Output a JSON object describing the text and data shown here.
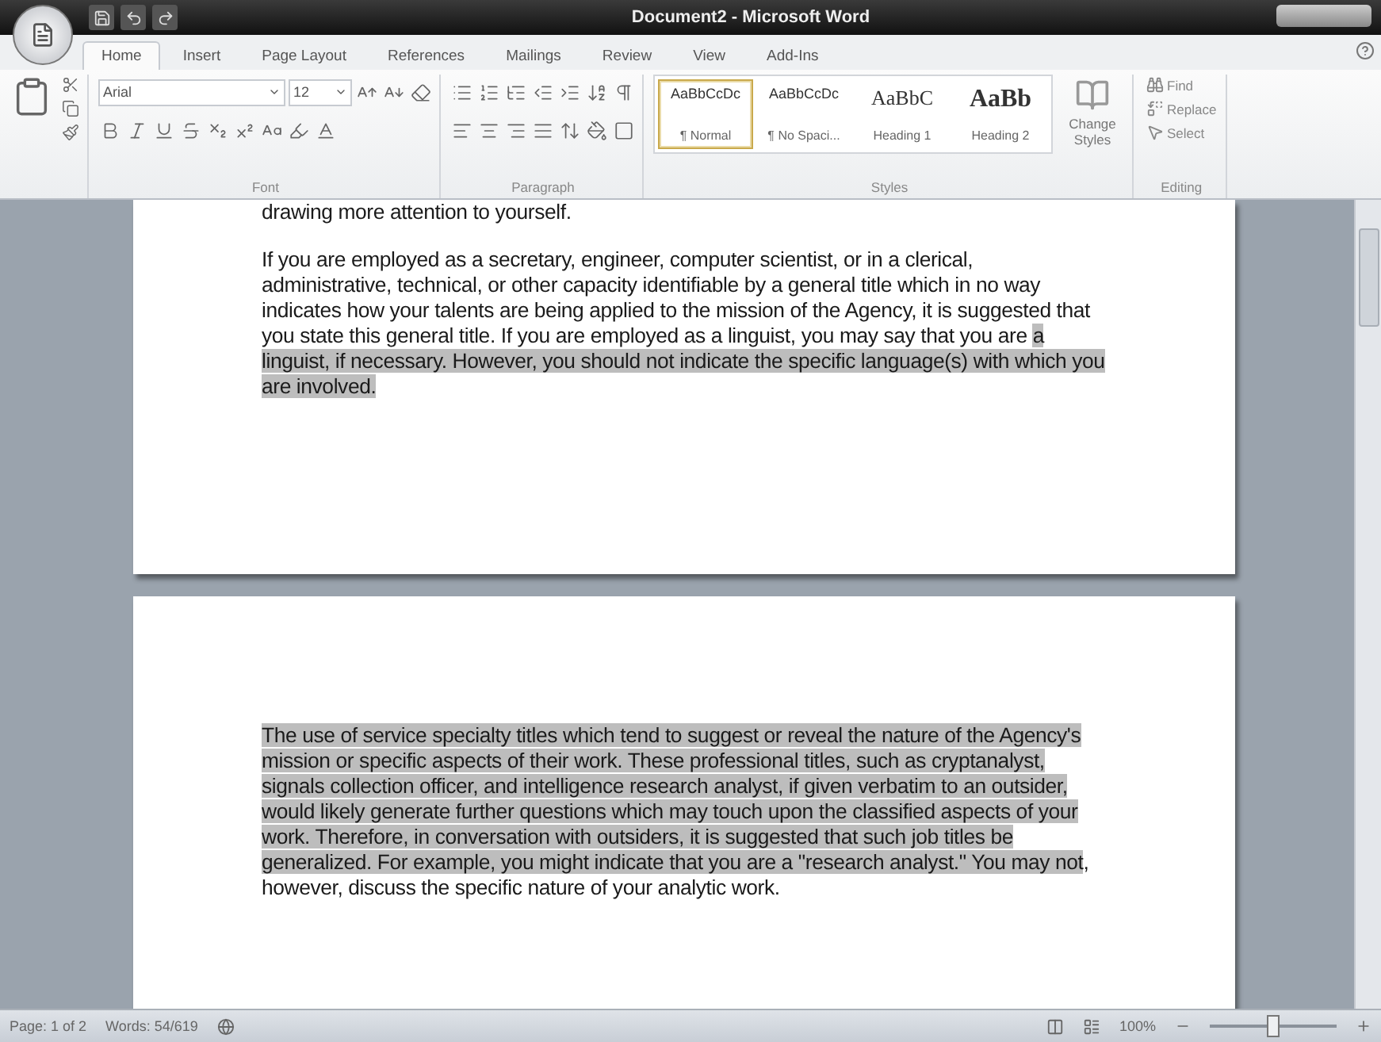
{
  "window": {
    "title": "Document2 - Microsoft Word"
  },
  "ribbon": {
    "tabs": [
      {
        "label": "Home",
        "selected": true
      },
      {
        "label": "Insert",
        "selected": false
      },
      {
        "label": "Page Layout",
        "selected": false
      },
      {
        "label": "References",
        "selected": false
      },
      {
        "label": "Mailings",
        "selected": false
      },
      {
        "label": "Review",
        "selected": false
      },
      {
        "label": "View",
        "selected": false
      },
      {
        "label": "Add-Ins",
        "selected": false
      }
    ],
    "font": {
      "name": "Arial",
      "size": "12",
      "label": "Font"
    },
    "paragraph": {
      "label": "Paragraph"
    },
    "styles": {
      "label": "Styles",
      "items": [
        {
          "sample": "AaBbCcDc",
          "label": "¶ Normal",
          "kind": "body",
          "selected": true
        },
        {
          "sample": "AaBbCcDc",
          "label": "¶ No Spaci...",
          "kind": "body",
          "selected": false
        },
        {
          "sample": "AaBbC",
          "label": "Heading 1",
          "kind": "heading1",
          "selected": false
        },
        {
          "sample": "AaBb",
          "label": "Heading 2",
          "kind": "heading2",
          "selected": false
        }
      ],
      "change": "Change Styles"
    },
    "editing": {
      "label": "Editing",
      "items": [
        {
          "label": "Find",
          "kind": "find"
        },
        {
          "label": "Replace",
          "kind": "replace"
        },
        {
          "label": "Select",
          "kind": "select"
        }
      ]
    }
  },
  "document": {
    "pages": [
      {
        "paragraphs": [
          {
            "segments": [
              {
                "text": "drawing more attention to yourself.",
                "selected": false
              }
            ]
          },
          {
            "segments": [
              {
                "text": "If you are employed as a secretary, engineer, computer scientist, or in a clerical, administrative, technical, or other capacity identifiable by a general title which in no way indicates how your talents are being applied to the mission of the Agency, it is suggested that you state this general title.  If you are employed as a linguist, you may say that you are ",
                "selected": false
              },
              {
                "text": "a linguist, if necessary. However, you should not indicate the specific language(s) with which you are involved.",
                "selected": true
              }
            ]
          }
        ]
      },
      {
        "paragraphs": [
          {
            "segments": [
              {
                "text": "The use of service specialty titles which tend to suggest or reveal the nature of the Agency's mission or specific aspects of their work. These professional titles, such as cryptanalyst, signals collection officer, and intelligence research analyst, if given verbatim to an outsider, would likely generate further questions which may touch upon the classified aspects of your work. Therefore, in conversation with outsiders, it is suggested that such job titles be generalized. For example, you might indicate that you are a \"research analyst.\" You may not",
                "selected": true
              },
              {
                "text": ", however, discuss the specific nature of your analytic work.",
                "selected": false
              }
            ]
          }
        ]
      }
    ]
  },
  "status_bar": {
    "page": "Page: 1 of 2",
    "words": "Words: 54/619",
    "zoom": "100%",
    "zoom_slider": {
      "level": 0.5
    }
  }
}
